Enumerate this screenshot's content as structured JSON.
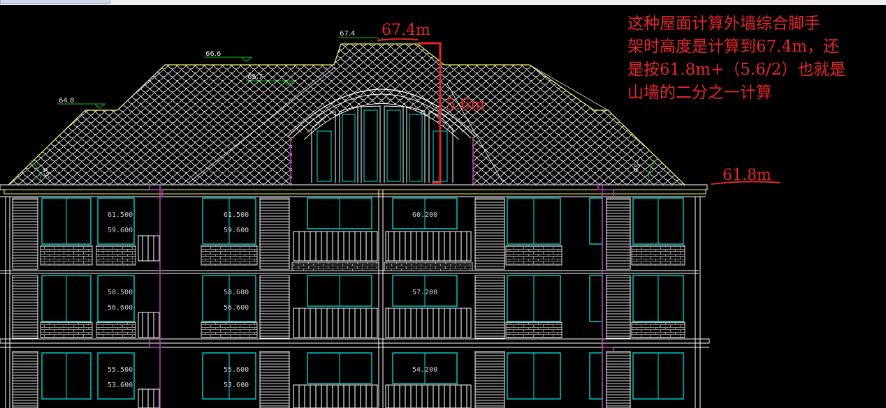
{
  "window": {
    "tab_label": ""
  },
  "colors": {
    "background": "#000000",
    "annotation": "#e8262a",
    "linework": "#ffffff",
    "window": "#00e5e5",
    "magenta": "#c040c0",
    "eave": "#f0f060",
    "dimension": "#19c019"
  },
  "annotations": {
    "top_height": "67.4m",
    "dormer_height": "5.6m",
    "eave_height": "61.8m"
  },
  "question": {
    "lines": [
      "这种屋面计算外墙综合脚手",
      "架时高度是计算到67.4m，还",
      "是按61.8m+（5.6/2）也就是",
      "山墙的二分之一计算"
    ]
  },
  "roof_levels": {
    "ridge": "67.4",
    "upper_left": "66.6",
    "mid": "65.7",
    "left_eave": "64.8",
    "angle_left": "45°",
    "angle_right": "45°"
  },
  "floor_marks": {
    "row1": [
      "61.500",
      "59.600",
      "61.500",
      "59.600",
      "60.200"
    ],
    "row2": [
      "58.500",
      "56.600",
      "58.600",
      "56.600",
      "57.200"
    ],
    "row3": [
      "55.500",
      "53.600",
      "55.600",
      "53.600",
      "54.200"
    ]
  }
}
